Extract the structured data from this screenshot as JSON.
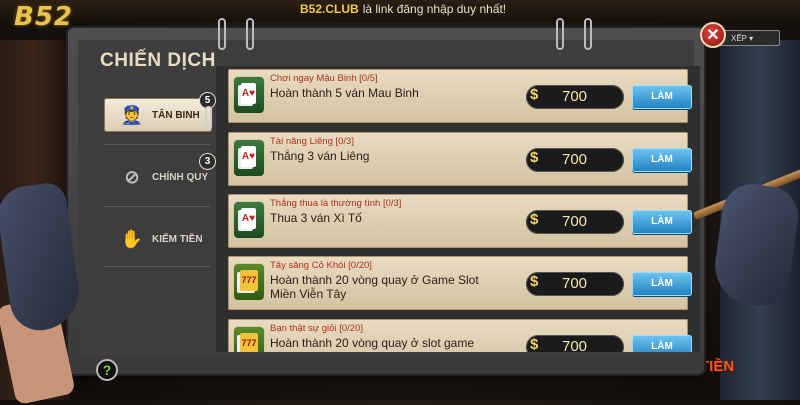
{
  "top_banner": {
    "logo": "B52",
    "club": "B52.CLUB",
    "message": "là link đăng nhập duy nhất!"
  },
  "background": {
    "sort_label": "XẾP",
    "side_text": "TIỀN"
  },
  "dialog": {
    "title": "CHIẾN DỊCH",
    "close_symbol": "✕",
    "help_symbol": "?",
    "tabs": [
      {
        "label": "TÂN BINH",
        "badge": "5",
        "active": true,
        "icon": "soldier-icon"
      },
      {
        "label": "CHÍNH QUY",
        "badge": "3",
        "active": false,
        "icon": "target-icon"
      },
      {
        "label": "KIẾM TIỀN",
        "badge": "",
        "active": false,
        "icon": "money-hand-icon"
      }
    ],
    "missions": [
      {
        "title": "Chơi ngay Mậu Binh",
        "count": "[0/5]",
        "desc": "Hoàn thành 5 ván Mau Binh",
        "reward": "700",
        "button": "LÀM",
        "icon": "cards-icon"
      },
      {
        "title": "Tài năng Liêng",
        "count": "[0/3]",
        "desc": "Thắng 3 ván Liêng",
        "reward": "700",
        "button": "LÀM",
        "icon": "cards-icon"
      },
      {
        "title": "Thắng thua là thường tình",
        "count": "[0/3]",
        "desc": "Thua 3 ván Xì Tố",
        "reward": "700",
        "button": "LÀM",
        "icon": "cards-icon"
      },
      {
        "title": "Tây săng Cỏ Khói",
        "count": "[0/20]",
        "desc": "Hoàn thành 20 vòng quay ở Game Slot Miền Viễn Tây",
        "reward": "700",
        "button": "LÀM",
        "icon": "slot-777-icon"
      },
      {
        "title": "Bạn thật sự giỏi",
        "count": "[0/20]",
        "desc": "Hoàn thành 20 vòng quay ở slot game",
        "reward": "700",
        "button": "LÀM",
        "icon": "slot-777-icon"
      }
    ],
    "currency_symbol": "$"
  }
}
